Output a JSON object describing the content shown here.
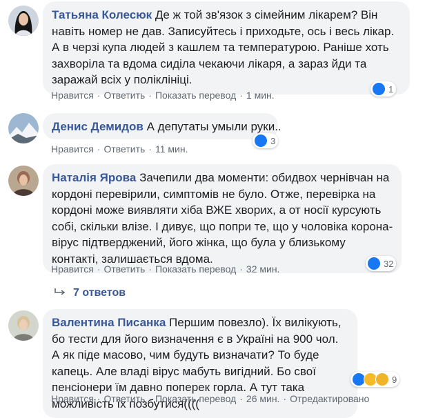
{
  "comments": [
    {
      "author": "Татьяна Колесюк",
      "text": "Де ж той зв'язок з сімейним лікарем? Він навіть номер не дав. Записуйтесь і приходьте, ось і весь лікар. А в черзі купа людей з кашлем та температурою. Раніше хоть захворіла та вдома сиділа чекаючи лікаря, а зараз йди та заражай всіх у поліклініці.",
      "like": "Нравится",
      "reply": "Ответить",
      "translate": "Показать перевод",
      "time": "1 мин.",
      "reactions": "1"
    },
    {
      "author": "Денис Демидов",
      "text": "А депутаты умыли руки..",
      "like": "Нравится",
      "reply": "Ответить",
      "time": "11 мин.",
      "reactions": "3"
    },
    {
      "author": "Наталія Ярова",
      "text": "Зачепили два моменти: обидвох чернівчан на кордоні перевірили, симптомів не було. Отже, перевірка на кордоні може виявляти хіба ВЖЕ хворих, а от носії курсують собі, скільки влізе. І дивує, що попри те, що у чоловіка корона-вірус підтверджений, його жінка, що була у близькому контакті, залишається вдома.",
      "like": "Нравится",
      "reply": "Ответить",
      "translate": "Показать перевод",
      "time": "32 мин.",
      "reactions": "32"
    },
    {
      "author": "Валентина Писанка",
      "text": "Першим повезло). Їх вилікують, бо тести для його визначення є в Україні на 900 чол. А як піде масово, чим будуть визначати? То буде капець. Але владі вірус мабуть вигідний. Бо свої пенсіонери їм давно поперек горла. А тут така можливість їх позбутися((((",
      "like": "Нравится",
      "reply": "Ответить",
      "translate": "Показать перевод",
      "time": "26 мин.",
      "edited": "Отредактировано",
      "reactions": "9"
    }
  ],
  "replies_link": "7 ответов",
  "colors": {
    "link": "#385898",
    "meta": "#606770",
    "bubble": "#f2f3f5",
    "like_blue": "#1877f2",
    "haha_yellow": "#f7b928"
  }
}
